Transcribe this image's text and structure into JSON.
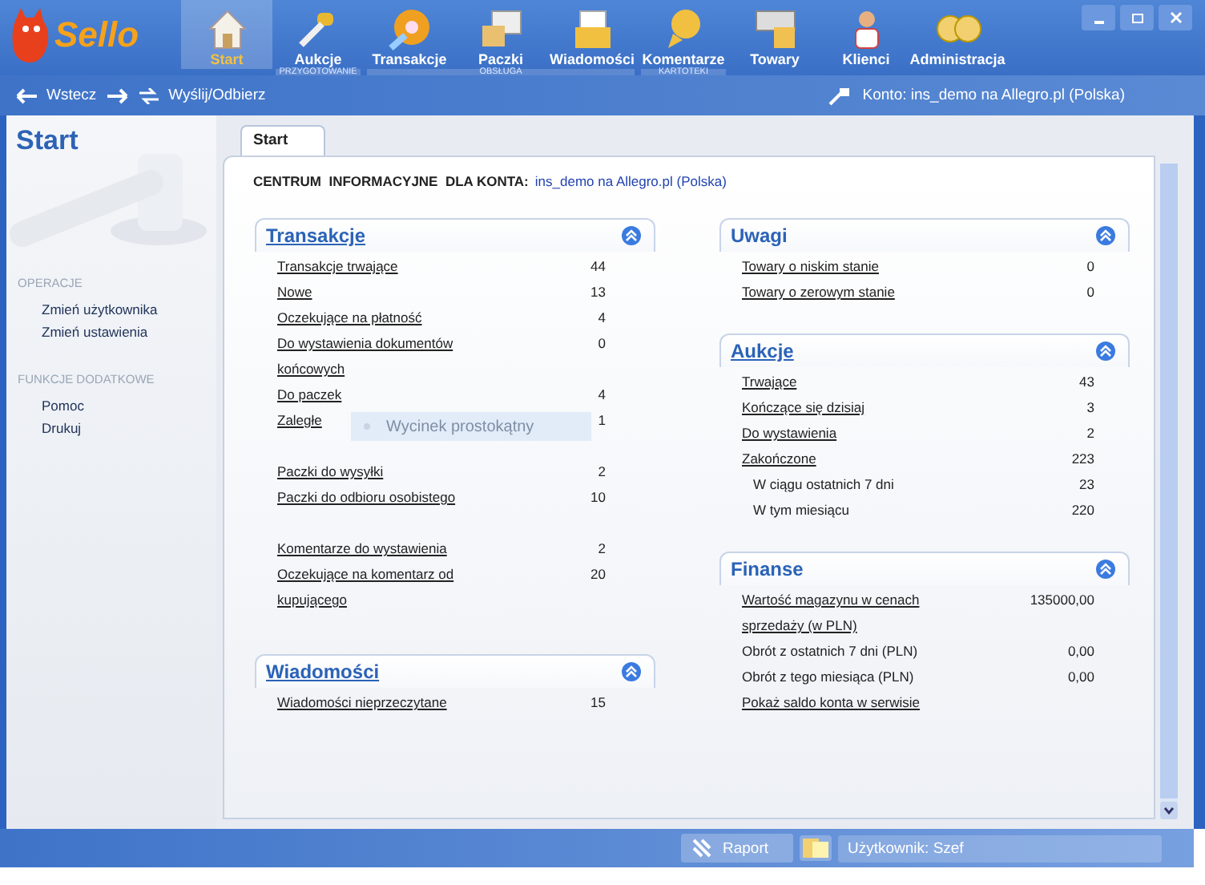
{
  "app": {
    "logo": "Sello"
  },
  "nav": {
    "groups": [
      {
        "items": [
          {
            "label": "Start",
            "selected": true
          }
        ]
      },
      {
        "label": "PRZYGOTOWANIE",
        "items": [
          {
            "label": "Aukcje",
            "selected": false
          }
        ]
      },
      {
        "label": "OBSŁUGA",
        "items": [
          {
            "label": "Transakcje",
            "selected": false
          },
          {
            "label": "Paczki",
            "selected": false
          },
          {
            "label": "Wiadomości",
            "selected": false
          }
        ]
      },
      {
        "label": "KARTOTEKI",
        "items": [
          {
            "label": "Komentarze",
            "selected": false
          }
        ]
      },
      {
        "items": [
          {
            "label": "Towary",
            "selected": false
          },
          {
            "label": "Klienci",
            "selected": false
          },
          {
            "label": "Administracja",
            "selected": false
          }
        ]
      }
    ]
  },
  "toolbar": {
    "back": "Wstecz",
    "send": "Wyślij/Odbierz",
    "account": "Konto: ins_demo na Allegro.pl (Polska)"
  },
  "sidebar": {
    "title": "Start",
    "sections": [
      {
        "title": "OPERACJE",
        "items": [
          "Zmień użytkownika",
          "Zmień ustawienia"
        ]
      },
      {
        "title": "FUNKCJE DODATKOWE",
        "items": [
          "Pomoc",
          "Drukuj"
        ]
      }
    ]
  },
  "tabs": [
    {
      "label": "Start",
      "selected": true
    }
  ],
  "heading": {
    "label": "CENTRUM  INFORMACYJNE  DLA KONTA:",
    "account": "ins_demo na Allegro.pl (Polska)"
  },
  "columns": [
    [
      {
        "title": "Transakcje",
        "title_link": true,
        "groups": [
          [
            {
              "label": "Transakcje trwające",
              "value": "44",
              "kind": "link"
            },
            {
              "label": "Nowe",
              "value": "13",
              "kind": "link"
            },
            {
              "label": "Oczekujące na płatność",
              "value": "4",
              "kind": "link"
            },
            {
              "label": "Do wystawienia dokumentów końcowych",
              "value": "0",
              "kind": "link"
            },
            {
              "label": "Do paczek",
              "value": "4",
              "kind": "link"
            },
            {
              "label": "Zaległe",
              "value": "1",
              "kind": "link"
            }
          ],
          [
            {
              "label": "Paczki do wysyłki",
              "value": "2",
              "kind": "link"
            },
            {
              "label": "Paczki do odbioru osobistego",
              "value": "10",
              "kind": "link"
            }
          ],
          [
            {
              "label": "Komentarze do wystawienia",
              "value": "2",
              "kind": "link"
            },
            {
              "label": "Oczekujące na komentarz od kupującego",
              "value": "20",
              "kind": "link"
            }
          ]
        ]
      },
      {
        "title": "Wiadomości",
        "title_link": true,
        "groups": [
          [
            {
              "label": "Wiadomości nieprzeczytane",
              "value": "15",
              "kind": "link"
            }
          ]
        ]
      }
    ],
    [
      {
        "title": "Uwagi",
        "title_link": false,
        "groups": [
          [
            {
              "label": "Towary o niskim stanie",
              "value": "0",
              "kind": "link"
            },
            {
              "label": "Towary o zerowym stanie",
              "value": "0",
              "kind": "link"
            }
          ]
        ]
      },
      {
        "title": "Aukcje",
        "title_link": true,
        "groups": [
          [
            {
              "label": "Trwające",
              "value": "43",
              "kind": "link"
            },
            {
              "label": "Kończące się dzisiaj",
              "value": "3",
              "kind": "link"
            },
            {
              "label": "Do wystawienia",
              "value": "2",
              "kind": "link"
            },
            {
              "label": "Zakończone",
              "value": "223",
              "kind": "link",
              "children": [
                {
                  "label": "W ciągu ostatnich 7 dni",
                  "value": "23"
                },
                {
                  "label": "W tym miesiącu",
                  "value": "220"
                }
              ]
            }
          ]
        ]
      },
      {
        "title": "Finanse",
        "title_link": false,
        "groups": [
          [
            {
              "label": "Wartość magazynu w cenach sprzedaży (w PLN)",
              "value": "135000,00",
              "kind": "link"
            },
            {
              "label": "Obrót z ostatnich 7 dni (PLN)",
              "value": "0,00",
              "kind": "plain"
            },
            {
              "label": "Obrót z tego miesiąca (PLN)",
              "value": "0,00",
              "kind": "plain"
            },
            {
              "label": "Pokaż saldo konta w serwisie",
              "kind": "link"
            }
          ]
        ]
      }
    ]
  ],
  "overlay": {
    "label": "Wycinek prostokątny"
  },
  "status_bar": {
    "report": "Raport",
    "user": "Użytkownik: Szef"
  }
}
